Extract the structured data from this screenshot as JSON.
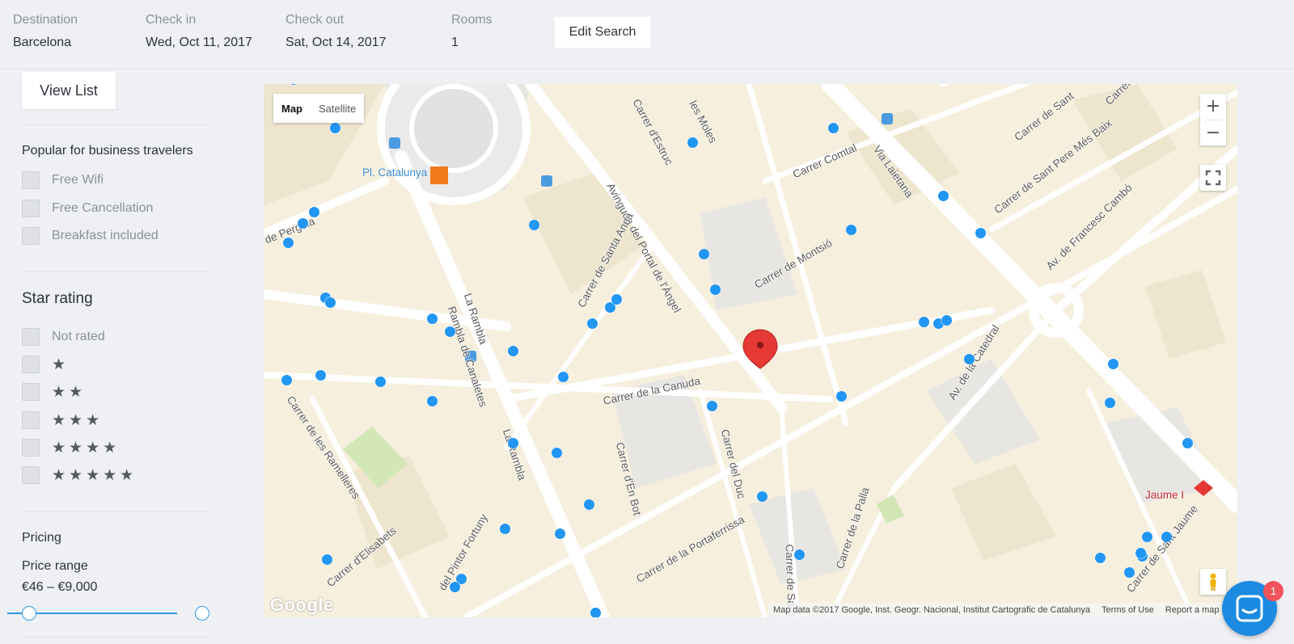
{
  "search": {
    "destination_label": "Destination",
    "destination_value": "Barcelona",
    "checkin_label": "Check in",
    "checkin_value": "Wed, Oct 11, 2017",
    "checkout_label": "Check out",
    "checkout_value": "Sat, Oct 14, 2017",
    "rooms_label": "Rooms",
    "rooms_value": "1",
    "edit_button": "Edit Search"
  },
  "sidebar": {
    "view_list_button": "View List",
    "business_title": "Popular for business travelers",
    "business_filters": [
      "Free Wifi",
      "Free Cancellation",
      "Breakfast included"
    ],
    "star_title": "Star rating",
    "not_rated": "Not rated",
    "star_glyphs": [
      "★",
      "★★",
      "★★★",
      "★★★★",
      "★★★★★"
    ],
    "pricing_title": "Pricing",
    "price_range_label": "Price range",
    "price_range_value": "€46 – €9,000",
    "price_slider": {
      "min": 46,
      "max": 9000,
      "low": 46,
      "high": 9000
    }
  },
  "map": {
    "type_buttons": {
      "map": "Map",
      "satellite": "Satellite"
    },
    "active_type": "map",
    "zoom_in": "+",
    "zoom_out": "−",
    "logo": "Google",
    "attribution": "Map data ©2017 Google, Inst. Geogr. Nacional, Institut Cartografic de Catalunya",
    "terms": "Terms of Use",
    "report": "Report a map err",
    "poi": {
      "plaza": "Pl. Catalunya",
      "metro": "Jaume I"
    },
    "street_labels": [
      "Carrer d'Estruc",
      "les Moles",
      "Carrer Comtal",
      "Via Laietana",
      "Carrer de Sant",
      "Carrer de Sant Pere Més Baix",
      "Carrer",
      "Avinguda del Portal de l'Àngel",
      "Carrer de Montsió",
      "Av. de Francesc Cambó",
      "Carrer de Santa Anna",
      "La Rambla",
      "Rambla de Canaletes",
      "Carrer de la Canuda",
      "Av. de la Catedral",
      "Carrer de les Ramelleres",
      "La Rambla",
      "Carrer d'En Bot",
      "Carrer del Duc",
      "Carrer de la Portaferrissa",
      "Carrer de la Palla",
      "Carrer d'Elisabets",
      "Carrer de Pergola",
      "Carrer de Sant Domènec",
      "Carrer de Sant Jaume",
      "Carrer del Pintor Fortuny"
    ],
    "street_labels_render": [
      "Carrer d'Estruc",
      "les Moles",
      "Carrer Comtal",
      "Via Laietana",
      "Carrer de Sant",
      "Carrer de Sant Pere Més Baix",
      "Carrer",
      "Avinguda del Portal de l'Àngel",
      "Carrer de Montsió",
      "Av. de Francesc Cambó",
      "Carrer de Santa Anna",
      "La Rambla",
      "Rambla de Canaletes",
      "Carrer de la Canuda",
      "Av. de la Catedral",
      "Carrer de les Ramelleres",
      "La Rambla",
      "Carrer d'En Bot",
      "Carrer del Duc",
      "Carrer de la Portaferrissa",
      "Carrer de la Palla",
      "Carrer d'Elisabets",
      "de Pergola",
      "Carrer de Sant Dom",
      "Carrer de Sant Jaume",
      "del Pintor Fortuny"
    ]
  },
  "chat": {
    "badge_count": "1"
  },
  "colors": {
    "accent": "#2196f3",
    "pin": "#e53935",
    "chat": "#1b8ae0",
    "badge": "#f2545b"
  }
}
